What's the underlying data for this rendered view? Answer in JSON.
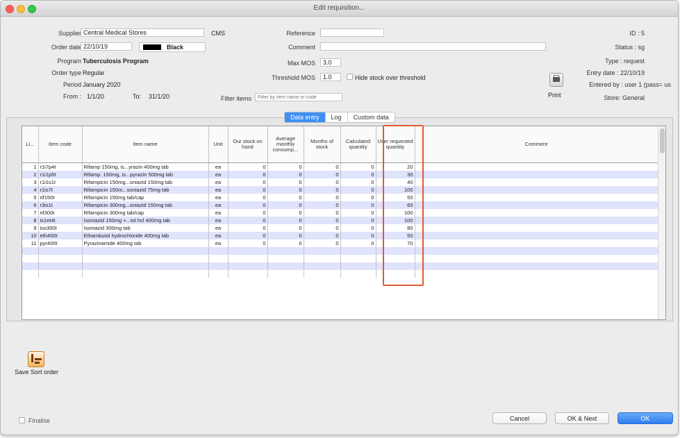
{
  "window": {
    "title": "Edit requisition..."
  },
  "header": {
    "supplier_label": "Supplier",
    "supplier_value": "Central Medical Stores",
    "supplier_code": "CMS",
    "order_date_label": "Order date",
    "order_date_value": "22/10/19",
    "color_name": "Black",
    "program_label": "Program",
    "program_value": "Tuberculosis Program",
    "order_type_label": "Order type",
    "order_type_value": "Regular",
    "period_label": "Period",
    "period_value": "January 2020",
    "from_label": "From :",
    "from_value": "1/1/20",
    "to_label": "To:",
    "to_value": "31/1/20",
    "reference_label": "Reference",
    "reference_value": "",
    "comment_label": "Comment",
    "comment_value": "",
    "max_mos_label": "Max MOS",
    "max_mos_value": "3.0",
    "threshold_label": "Threshold MOS",
    "threshold_value": "1.0",
    "hide_stock_label": "Hide stock over threshold",
    "filter_label": "Filter items",
    "filter_placeholder": "Filter by item name or code"
  },
  "info": {
    "id": "ID : 5",
    "status": "Status : sg",
    "type": "Type : request",
    "entry_date": "Entry date : 22/10/19",
    "entered_by": "Entered by : user 1 (pass= us",
    "store": "Store: General"
  },
  "print_label": "Print",
  "tabs": [
    "Data entry",
    "Log",
    "Custom data"
  ],
  "table": {
    "columns": [
      "Li...",
      "Item code",
      "Item name",
      "Unit",
      "Our stock on hand",
      "Average monthly consump...",
      "Months of stock",
      "Calculated quantity",
      "User requested quantity",
      "Comment"
    ],
    "rows": [
      [
        "1",
        "r1i7p4t",
        "Rifamp 150mg, is...yrazin 400mg tab",
        "ea",
        "0",
        "0",
        "0",
        "0",
        "20",
        ""
      ],
      [
        "2",
        "r1i1p5t",
        "Rifamp. 150mg, is...pyrazin 500mg tab",
        "ea",
        "0",
        "0",
        "0",
        "0",
        "30",
        ""
      ],
      [
        "3",
        "r1i1s1t",
        "Rifampicin 150mg...oniazid 150mg tab",
        "ea",
        "0",
        "0",
        "0",
        "0",
        "40",
        ""
      ],
      [
        "4",
        "r1is7t",
        "Rifampicin 150m...soniazid 75mg tab",
        "ea",
        "0",
        "0",
        "0",
        "0",
        "100",
        ""
      ],
      [
        "5",
        "rif150t",
        "Rifampicin 150mg tab/cap",
        "ea",
        "0",
        "0",
        "0",
        "0",
        "50",
        ""
      ],
      [
        "6",
        "r3is1t",
        "Rifampicin 300mg...oniazid 150mg tab",
        "ea",
        "0",
        "0",
        "0",
        "0",
        "60",
        ""
      ],
      [
        "7",
        "rif300t",
        "Rifampicin 300mg tab/cap",
        "ea",
        "0",
        "0",
        "0",
        "0",
        "100",
        ""
      ],
      [
        "8",
        "is1et4t",
        "Isoniazid 150mg +...tol hcl 400mg tab",
        "ea",
        "0",
        "0",
        "0",
        "0",
        "100",
        ""
      ],
      [
        "9",
        "iso300t",
        "Isoniazid 300mg tab",
        "ea",
        "0",
        "0",
        "0",
        "0",
        "80",
        ""
      ],
      [
        "10",
        "eth400t",
        "Ethambutol hydrochloride 400mg tab",
        "ea",
        "0",
        "0",
        "0",
        "0",
        "50",
        ""
      ],
      [
        "11",
        "pyr400t",
        "Pyrazinamide 400mg tab",
        "ea",
        "0",
        "0",
        "0",
        "0",
        "70",
        ""
      ]
    ]
  },
  "save_sort_label": "Save Sort order",
  "finalise_label": "Finalise",
  "buttons": {
    "cancel": "Cancel",
    "ok_next": "OK & Next",
    "ok": "OK"
  }
}
